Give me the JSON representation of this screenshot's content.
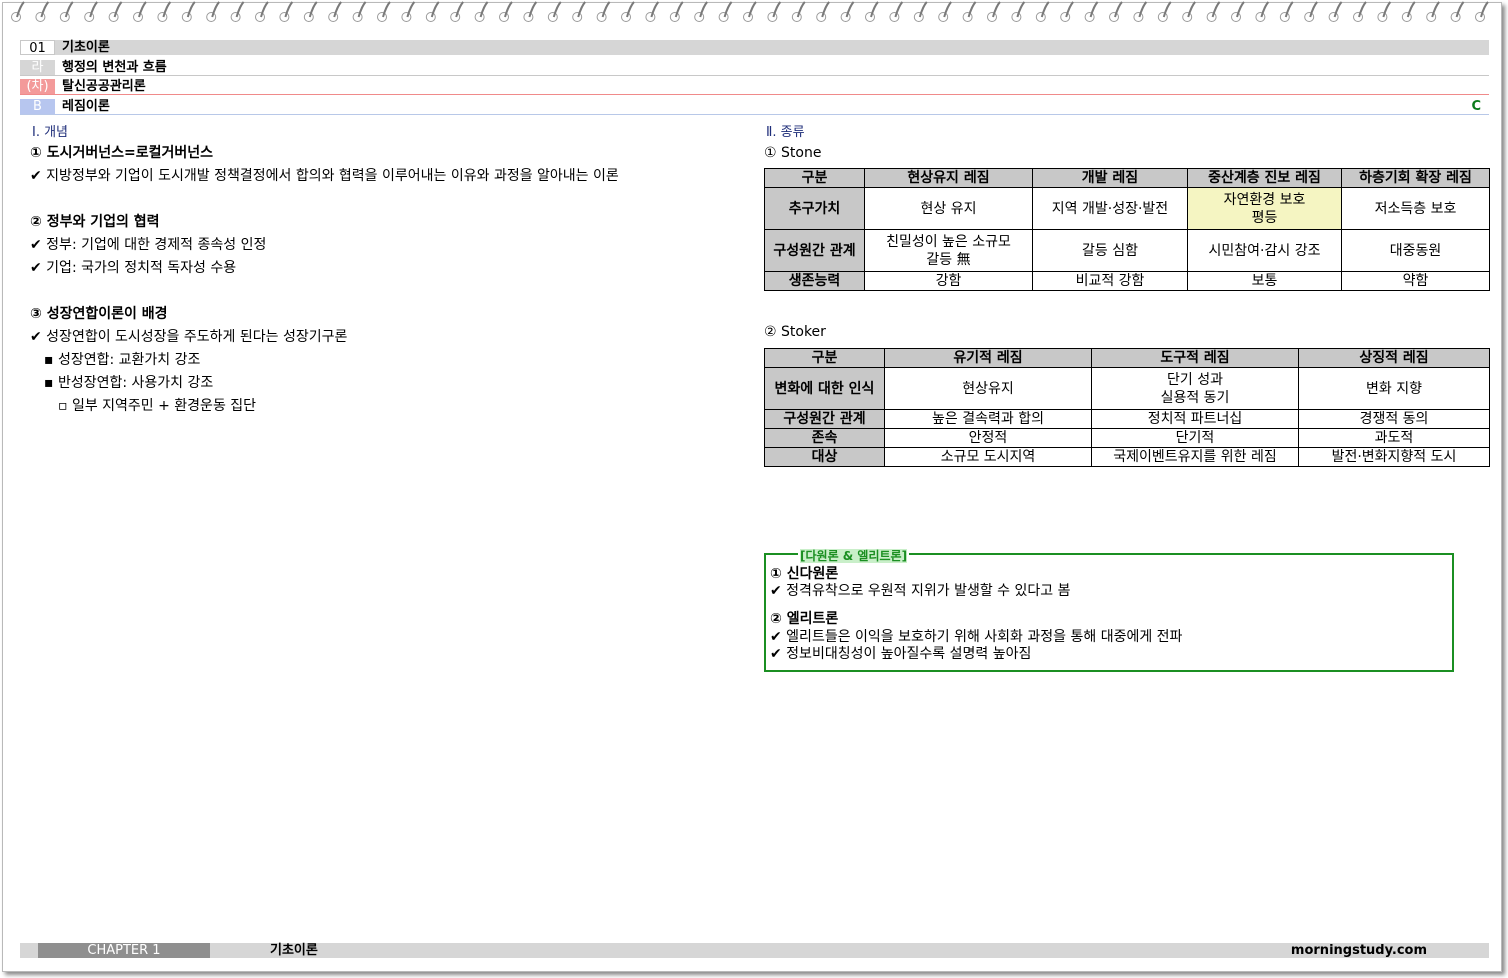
{
  "header": {
    "rows": [
      {
        "tag": "01",
        "text": "기초이론"
      },
      {
        "tag": "라",
        "text": "행정의 변천과 흐름"
      },
      {
        "tag": "(차)",
        "text": "탈신공공관리론"
      },
      {
        "tag": "B",
        "text": "레짐이론"
      }
    ],
    "right_mark": "C"
  },
  "left": {
    "section_title": "Ⅰ. 개념",
    "blocks": [
      {
        "heading": "① 도시거버넌스=로컬거버넌스",
        "lines": [
          "✔ 지방정부와 기업이 도시개발 정책결정에서 합의와 협력을 이루어내는 이유와 과정을 알아내는 이론"
        ]
      },
      {
        "heading": "② 정부와 기업의 협력",
        "lines": [
          "✔ 정부: 기업에 대한 경제적 종속성 인정",
          "✔ 기업: 국가의 정치적 독자성 수용"
        ]
      },
      {
        "heading": "③ 성장연합이론이 배경",
        "lines": [
          "✔ 성장연합이 도시성장을 주도하게 된다는 성장기구론",
          "▪ 성장연합: 교환가치 강조",
          "▪ 반성장연합: 사용가치 강조",
          "▫ 일부 지역주민 + 환경운동 집단"
        ]
      }
    ]
  },
  "right": {
    "section_title": "Ⅱ. 종류",
    "stone": {
      "heading": "① Stone",
      "headers": [
        "구분",
        "현상유지 레짐",
        "개발 레짐",
        "중산계층 진보 레짐",
        "하층기회 확장 레짐"
      ],
      "rows": [
        {
          "label": "추구가치",
          "cells": [
            "현상 유지",
            "지역 개발·성장·발전",
            "자연환경 보호\n평등",
            "저소득층 보호"
          ]
        },
        {
          "label": "구성원간 관계",
          "cells": [
            "친밀성이 높은 소규모\n갈등 無",
            "갈등 심함",
            "시민참여·감시 강조",
            "대중동원"
          ]
        },
        {
          "label": "생존능력",
          "cells": [
            "강함",
            "비교적 강함",
            "보통",
            "약함"
          ]
        }
      ]
    },
    "stoker": {
      "heading": "② Stoker",
      "headers": [
        "구분",
        "유기적 레짐",
        "도구적 레짐",
        "상징적 레짐"
      ],
      "rows": [
        {
          "label": "변화에 대한 인식",
          "cells": [
            "현상유지",
            "단기 성과\n실용적 동기",
            "변화 지향"
          ]
        },
        {
          "label": "구성원간 관계",
          "cells": [
            "높은 결속력과 합의",
            "정치적 파트너십",
            "경쟁적 동의"
          ]
        },
        {
          "label": "존속",
          "cells": [
            "안정적",
            "단기적",
            "과도적"
          ]
        },
        {
          "label": "대상",
          "cells": [
            "소규모 도시지역",
            "국제이벤트유지를 위한 레짐",
            "발전·변화지향적 도시"
          ]
        }
      ]
    },
    "box": {
      "title": "[다원론 & 엘리트론]",
      "h1": "① 신다원론",
      "l1": "✔ 정격유착으로 우원적 지위가 발생할 수 있다고 봄",
      "h2": "② 엘리트론",
      "l2": "✔ 엘리트들은 이익을 보호하기 위해 사회화 과정을 통해 대중에게 전파",
      "l3": "✔ 정보비대칭성이 높아질수록 설명력 높아짐"
    }
  },
  "footer": {
    "chapter": "CHAPTER 1",
    "title": "기초이론",
    "site": "morningstudy.com"
  }
}
